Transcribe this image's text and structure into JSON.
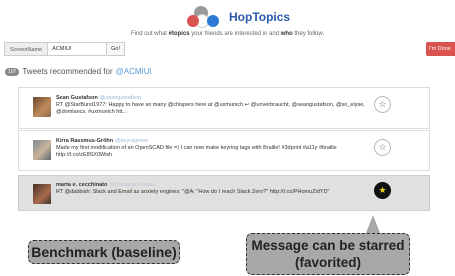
{
  "app": {
    "name": "HopTopics"
  },
  "tagline": {
    "part1": "Find out what ",
    "bold1": "#topics",
    "part2": " your friends are interested in and ",
    "bold2": "who",
    "part3": " they follow."
  },
  "search": {
    "label": "ScreenName",
    "value": "ACMIUI",
    "go_label": "Go!"
  },
  "done_label": "I'm Done",
  "recommendations": {
    "count": "107",
    "title": "Tweets recommended for",
    "handle": "@ACMIUI"
  },
  "tweets": [
    {
      "author": "Sean Gustafson",
      "handle": "@seangustafson",
      "text": "RT @StarBurst1977: Happy to have so many @chispers here at @uxmunich.↩ @unverbraucht, @seangustafson, @so_elyse, @domlancs. #uxmunich htt...",
      "starred": false
    },
    {
      "author": "Kirra Rassmus-Gröhn",
      "handle": "@keyragreen",
      "text": "Made my first modification of an OpenSCAD file =) I can now make keyring tags with Braille! #3dprint #a11y #braille http://t.co/zE8SX0Wish",
      "starred": false
    },
    {
      "author": "marta e. cecchinato",
      "handle": "@martacecchinato",
      "text": "RT @dabbish: Slack and Email as anxiety engines: \"@A: \"How do I reach Slack Zero?\" http://t.co/PHomuZidYD\"",
      "starred": true
    }
  ],
  "icons": {
    "star": "star-icon"
  },
  "callouts": {
    "left": "Benchmark (baseline)",
    "right_line1": "Message can be starred",
    "right_line2": "(favorited)"
  },
  "colors": {
    "accent": "#d9534f",
    "brand_blue": "#2b7bd6",
    "starred_bg": "#111111",
    "star_gold": "#f2d21b"
  }
}
